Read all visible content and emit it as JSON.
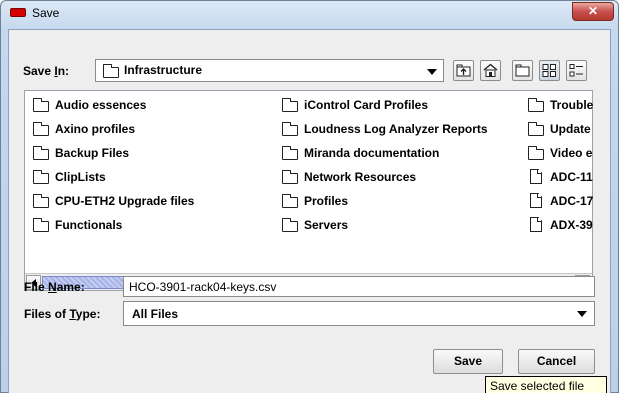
{
  "window": {
    "title": "Save",
    "close_glyph": "✕"
  },
  "save_in": {
    "label_pre": "Save ",
    "label_mnemonic": "I",
    "label_post": "n:",
    "value": "Infrastructure",
    "icon": "folder-icon"
  },
  "toolbar": {
    "buttons": [
      {
        "name": "up-one-level-icon"
      },
      {
        "name": "home-icon"
      },
      {
        "name": "new-folder-icon"
      },
      {
        "name": "list-view-icon"
      },
      {
        "name": "details-view-icon"
      }
    ]
  },
  "file_list": {
    "column1": [
      {
        "name": "Audio essences",
        "type": "folder"
      },
      {
        "name": "Axino profiles",
        "type": "folder"
      },
      {
        "name": "Backup Files",
        "type": "folder"
      },
      {
        "name": "ClipLists",
        "type": "folder"
      },
      {
        "name": "CPU-ETH2 Upgrade files",
        "type": "folder"
      },
      {
        "name": "Functionals",
        "type": "folder"
      }
    ],
    "column2": [
      {
        "name": "iControl Card Profiles",
        "type": "folder"
      },
      {
        "name": "Loudness Log Analyzer Reports",
        "type": "folder"
      },
      {
        "name": "Miranda documentation",
        "type": "folder"
      },
      {
        "name": "Network Resources",
        "type": "folder"
      },
      {
        "name": "Profiles",
        "type": "folder"
      },
      {
        "name": "Servers",
        "type": "folder"
      }
    ],
    "column3": [
      {
        "name": "Trouble",
        "type": "folder"
      },
      {
        "name": "Update",
        "type": "folder"
      },
      {
        "name": "Video e",
        "type": "folder"
      },
      {
        "name": "ADC-11",
        "type": "file"
      },
      {
        "name": "ADC-17",
        "type": "file"
      },
      {
        "name": "ADX-39",
        "type": "file"
      }
    ],
    "scroll_fraction": 0.38
  },
  "file_name": {
    "label_pre": "File ",
    "label_mnemonic": "N",
    "label_post": "ame:",
    "value": "HCO-3901-rack04-keys.csv"
  },
  "file_type": {
    "label_pre": "Files of ",
    "label_mnemonic": "T",
    "label_post": "ype:",
    "value": "All Files"
  },
  "buttons": {
    "save": "Save",
    "cancel": "Cancel"
  },
  "tooltip": "Save selected file"
}
